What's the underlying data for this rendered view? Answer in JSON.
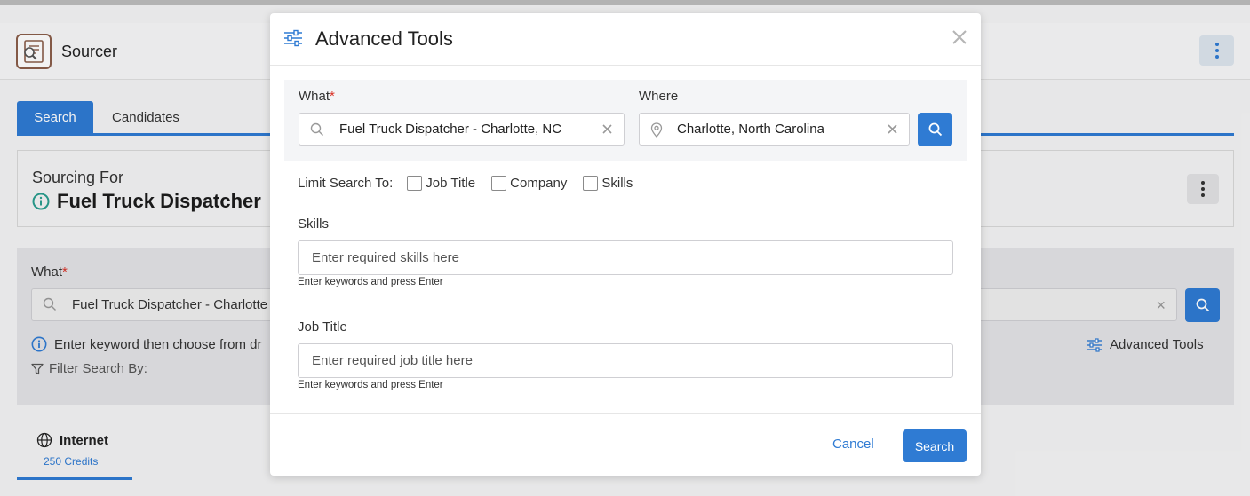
{
  "app": {
    "title": "Sourcer",
    "tabs": [
      {
        "label": "Search",
        "active": true
      },
      {
        "label": "Candidates",
        "active": false
      }
    ],
    "sourcing_for": {
      "label": "Sourcing For",
      "title": "Fuel Truck Dispatcher"
    },
    "search_panel": {
      "what_label": "What",
      "what_value": "Fuel Truck Dispatcher - Charlotte",
      "hint": "Enter keyword then choose from dr",
      "filter_label": "Filter Search By:",
      "advanced_tools_label": "Advanced Tools"
    },
    "sources": [
      {
        "label": "Internet",
        "credits": "250 Credits"
      }
    ]
  },
  "modal": {
    "title": "Advanced Tools",
    "what": {
      "label": "What",
      "value": "Fuel Truck Dispatcher - Charlotte, NC"
    },
    "where": {
      "label": "Where",
      "value": "Charlotte, North Carolina"
    },
    "limit_search": {
      "label": "Limit Search To:",
      "options": [
        {
          "label": "Job Title",
          "checked": false
        },
        {
          "label": "Company",
          "checked": false
        },
        {
          "label": "Skills",
          "checked": false
        }
      ]
    },
    "skills": {
      "label": "Skills",
      "placeholder": "Enter required skills here",
      "hint": "Enter keywords and press Enter"
    },
    "job_title": {
      "label": "Job Title",
      "placeholder": "Enter required job title here",
      "hint": "Enter keywords and press Enter"
    },
    "footer": {
      "cancel_label": "Cancel",
      "search_label": "Search"
    }
  },
  "colors": {
    "accent": "#2f7bd3",
    "required": "#d93025",
    "info": "#2a9d8f"
  }
}
